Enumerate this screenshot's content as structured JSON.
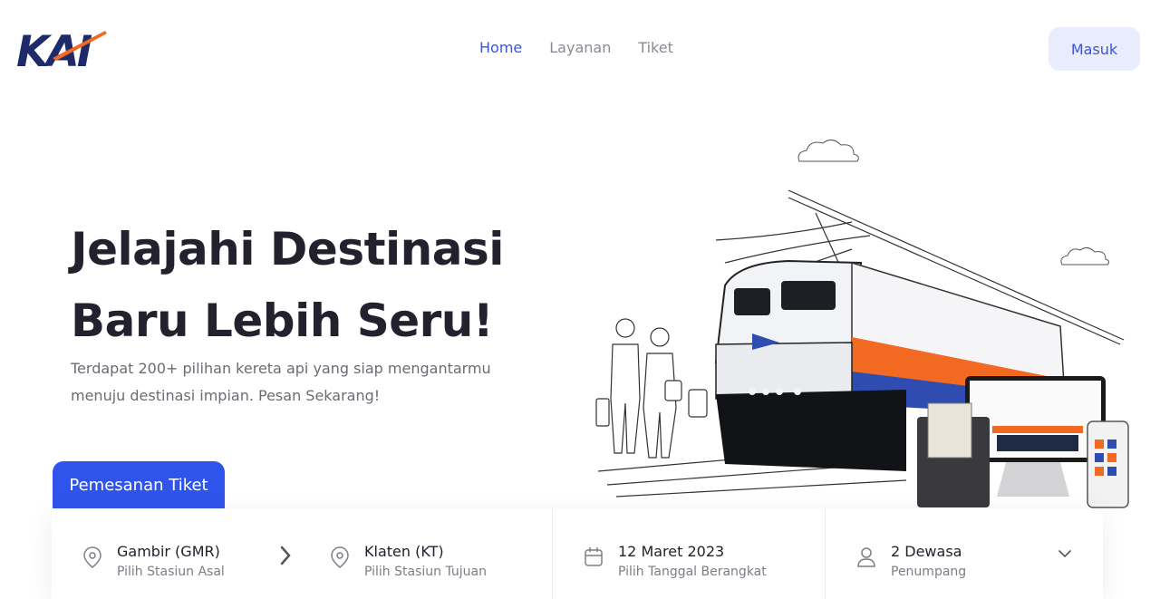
{
  "brand": {
    "logo_text": "KAI",
    "colors": {
      "navy": "#1f2a6b",
      "orange": "#f26a21",
      "accent": "#3a55d6",
      "primary": "#2f54eb"
    }
  },
  "nav": {
    "items": [
      {
        "label": "Home",
        "active": true
      },
      {
        "label": "Layanan",
        "active": false
      },
      {
        "label": "Tiket",
        "active": false
      }
    ]
  },
  "header": {
    "login_label": "Masuk"
  },
  "hero": {
    "title_line1": "Jelajahi Destinasi",
    "title_line2": "Baru Lebih Seru!",
    "subtitle_line1": "Terdapat 200+ pilihan kereta api yang siap mengantarmu",
    "subtitle_line2": "menuju destinasi impian. Pesan Sekarang!"
  },
  "booking": {
    "tab_label": "Pemesanan Tiket",
    "origin": {
      "value": "Gambir (GMR)",
      "hint": "Pilih Stasiun Asal",
      "icon": "location-pin-icon"
    },
    "destination": {
      "value": "Klaten (KT)",
      "hint": "Pilih Stasiun Tujuan",
      "icon": "location-pin-icon"
    },
    "date": {
      "value": "12 Maret 2023",
      "hint": "Pilih Tanggal Berangkat",
      "icon": "calendar-icon"
    },
    "passengers": {
      "value": "2 Dewasa",
      "hint": "Penumpang",
      "icon": "user-icon"
    }
  }
}
